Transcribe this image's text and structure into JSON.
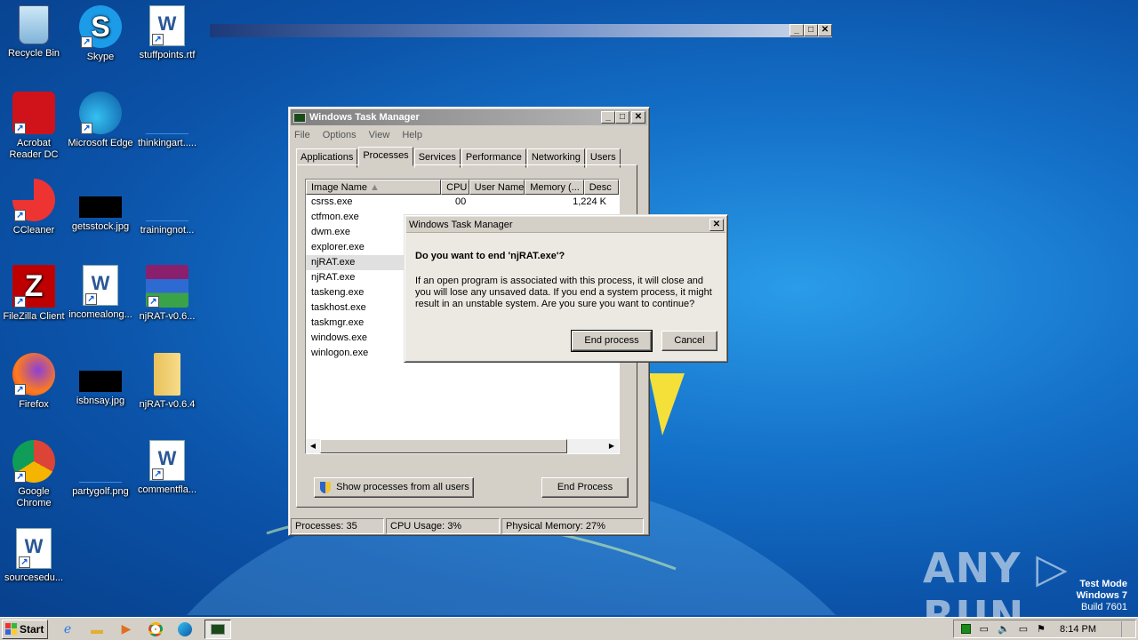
{
  "desktop": {
    "icons": [
      {
        "label": "Recycle Bin",
        "icon": "recycle-bin-icon"
      },
      {
        "label": "Skype",
        "icon": "skype-icon"
      },
      {
        "label": "stuffpoints.rtf",
        "icon": "word-document-icon"
      },
      {
        "label": "Acrobat Reader DC",
        "icon": "acrobat-icon"
      },
      {
        "label": "Microsoft Edge",
        "icon": "edge-icon"
      },
      {
        "label": "thinkingart.....",
        "icon": "image-file-icon"
      },
      {
        "label": "CCleaner",
        "icon": "ccleaner-icon"
      },
      {
        "label": "getsstock.jpg",
        "icon": "jpg-file-icon"
      },
      {
        "label": "trainingnot...",
        "icon": "image-file-icon"
      },
      {
        "label": "FileZilla Client",
        "icon": "filezilla-icon"
      },
      {
        "label": "incomealong...",
        "icon": "word-document-icon"
      },
      {
        "label": "njRAT-v0.6...",
        "icon": "winrar-icon"
      },
      {
        "label": "Firefox",
        "icon": "firefox-icon"
      },
      {
        "label": "isbnsay.jpg",
        "icon": "jpg-file-icon"
      },
      {
        "label": "njRAT-v0.6.4",
        "icon": "folder-icon"
      },
      {
        "label": "Google Chrome",
        "icon": "chrome-icon"
      },
      {
        "label": "partygolf.png",
        "icon": "png-file-icon"
      },
      {
        "label": "commentfla...",
        "icon": "word-document-icon"
      },
      {
        "label": "sourcesedu...",
        "icon": "word-document-icon"
      }
    ]
  },
  "strip": {
    "min": "_",
    "max": "□",
    "close": "✕"
  },
  "taskmgr": {
    "title": "Windows Task Manager",
    "menu": [
      "File",
      "Options",
      "View",
      "Help"
    ],
    "tabs": [
      "Applications",
      "Processes",
      "Services",
      "Performance",
      "Networking",
      "Users"
    ],
    "active_tab": "Processes",
    "columns": [
      "Image Name",
      "CPU",
      "User Name",
      "Memory (...",
      "Desc"
    ],
    "rows": [
      {
        "name": "csrss.exe",
        "cpu": "00",
        "memory": "1,224 K"
      },
      {
        "name": "ctfmon.exe"
      },
      {
        "name": "dwm.exe"
      },
      {
        "name": "explorer.exe"
      },
      {
        "name": "njRAT.exe",
        "selected": true
      },
      {
        "name": "njRAT.exe"
      },
      {
        "name": "taskeng.exe"
      },
      {
        "name": "taskhost.exe"
      },
      {
        "name": "taskmgr.exe"
      },
      {
        "name": "windows.exe"
      },
      {
        "name": "winlogon.exe"
      }
    ],
    "show_all_label": "Show processes from all users",
    "end_process_label": "End Process",
    "status": {
      "processes": "Processes: 35",
      "cpu": "CPU Usage: 3%",
      "memory": "Physical Memory: 27%"
    }
  },
  "dialog": {
    "title": "Windows Task Manager",
    "question": "Do you want to end 'njRAT.exe'?",
    "message": "If an open program is associated with this process, it will close and you will lose any unsaved data. If you end a system process, it might result in an unstable system. Are you sure you want to continue?",
    "confirm_label": "End process",
    "cancel_label": "Cancel"
  },
  "taskbar": {
    "start_label": "Start",
    "pinned": [
      "ie-icon",
      "explorer-icon",
      "media-player-icon",
      "chrome-icon",
      "edge-icon",
      "task-manager-icon"
    ],
    "clock": "8:14 PM"
  },
  "watermark": {
    "line1": "Test Mode",
    "line2": "Windows 7",
    "line3": "Build 7601",
    "brand": "ANY.RUN"
  }
}
